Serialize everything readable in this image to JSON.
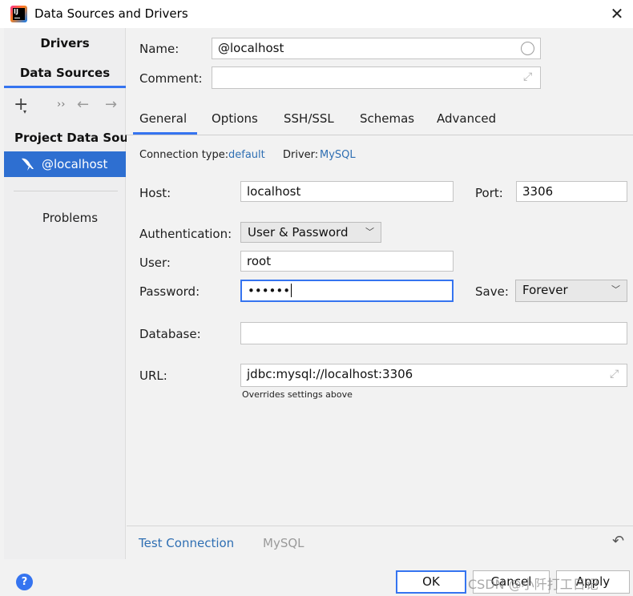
{
  "window": {
    "title": "Data Sources and Drivers",
    "close_glyph": "✕"
  },
  "app_icon": {
    "letters": "IJ"
  },
  "sidebar": {
    "tabs": {
      "drivers": "Drivers",
      "data_sources": "Data Sources"
    },
    "toolbar": {
      "add": "+",
      "add_arrow": "▾",
      "more": "››",
      "back": "←",
      "forward": "→"
    },
    "section_title": "Project Data Sour...",
    "selected_item": "@localhost",
    "problems": "Problems"
  },
  "form": {
    "name_label": "Name:",
    "name_value": "@localhost",
    "comment_label": "Comment:",
    "comment_value": "",
    "tabs": [
      "General",
      "Options",
      "SSH/SSL",
      "Schemas",
      "Advanced"
    ],
    "active_tab": "General",
    "connection_type_label": "Connection type:",
    "connection_type_value": "default",
    "driver_label": "Driver:",
    "driver_value": "MySQL",
    "host_label": "Host:",
    "host_value": "localhost",
    "port_label": "Port:",
    "port_value": "3306",
    "auth_label": "Authentication:",
    "auth_value": "User & Password",
    "user_label": "User:",
    "user_value": "root",
    "password_label": "Password:",
    "password_value": "••••••",
    "save_label": "Save:",
    "save_value": "Forever",
    "database_label": "Database:",
    "database_value": "",
    "url_label": "URL:",
    "url_value": "jdbc:mysql://localhost:3306",
    "url_hint": "Overrides settings above"
  },
  "footer": {
    "test_connection": "Test Connection",
    "driver_name": "MySQL",
    "revert_glyph": "↶"
  },
  "buttons": {
    "help": "?",
    "ok": "OK",
    "cancel": "Cancel",
    "apply": "Apply"
  },
  "watermark": "CSDN @小阡打工日记",
  "colors": {
    "accent": "#3574f0",
    "selection": "#2e6fd1",
    "link": "#2f6fb3"
  }
}
